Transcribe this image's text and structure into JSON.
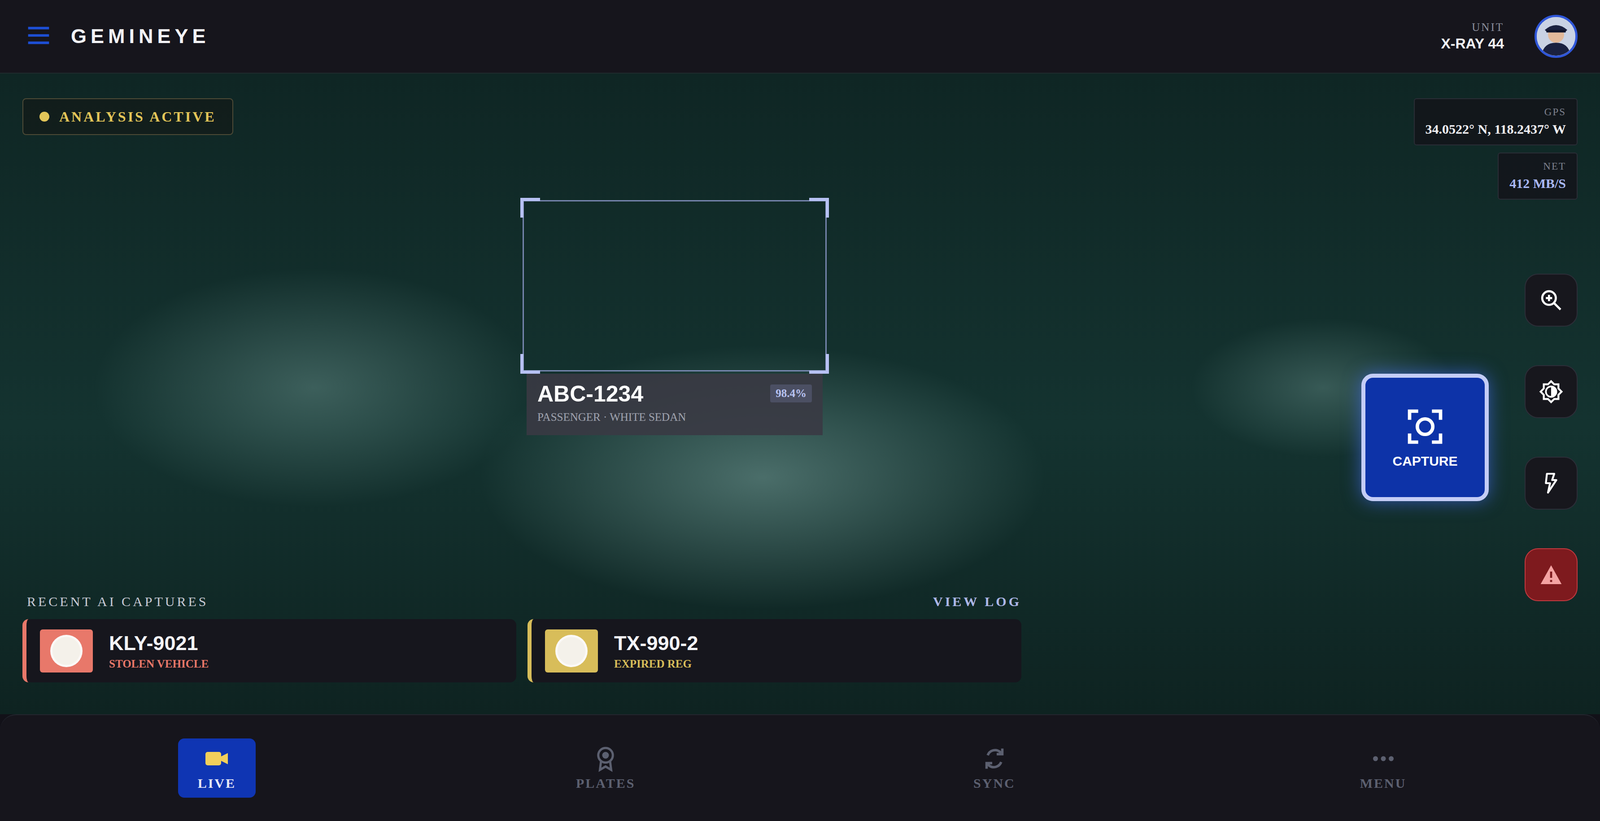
{
  "app": {
    "title": "GEMINEYE"
  },
  "unit": {
    "label": "UNIT",
    "name": "X-RAY 44"
  },
  "status": {
    "label": "ANALYSIS ACTIVE"
  },
  "telemetry": [
    {
      "label": "GPS",
      "value": "34.0522° N, 118.2437° W"
    },
    {
      "label": "NET",
      "value": "412 MB/S"
    }
  ],
  "detection": {
    "plate": "ABC-1234",
    "confidence": "98.4%",
    "description": "PASSENGER · WHITE SEDAN"
  },
  "capture_button": {
    "label": "CAPTURE"
  },
  "recent": {
    "title": "RECENT AI CAPTURES",
    "link": "VIEW LOG",
    "items": [
      {
        "plate": "KLY-9021",
        "status": "STOLEN VEHICLE",
        "color": "#e8786a"
      },
      {
        "plate": "TX-990-2",
        "status": "EXPIRED REG",
        "color": "#d8bd5a"
      }
    ]
  },
  "nav": [
    {
      "label": "LIVE",
      "selected": true
    },
    {
      "label": "PLATES",
      "selected": false
    },
    {
      "label": "SYNC",
      "selected": false
    },
    {
      "label": "MENU",
      "selected": false
    }
  ]
}
